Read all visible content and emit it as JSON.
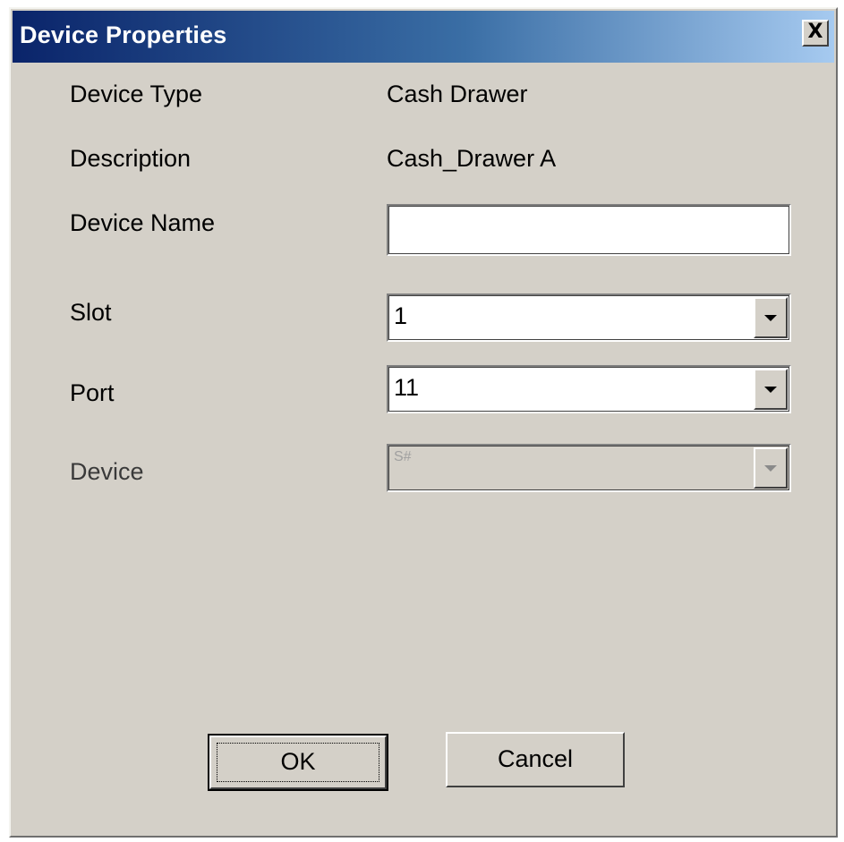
{
  "window": {
    "title": "Device Properties",
    "close_label": "X"
  },
  "fields": {
    "device_type": {
      "label": "Device Type",
      "value": "Cash Drawer"
    },
    "description": {
      "label": "Description",
      "value": "Cash_Drawer A"
    },
    "device_name": {
      "label": "Device Name",
      "value": ""
    },
    "slot": {
      "label": "Slot",
      "value": "1"
    },
    "port": {
      "label": "Port",
      "value": "11"
    },
    "device": {
      "label": "Device",
      "value": "S#"
    }
  },
  "buttons": {
    "ok": "OK",
    "cancel": "Cancel"
  },
  "colors": {
    "dialog_bg": "#d4d0c8",
    "title_start": "#0a246a",
    "title_end": "#a6caf0"
  }
}
